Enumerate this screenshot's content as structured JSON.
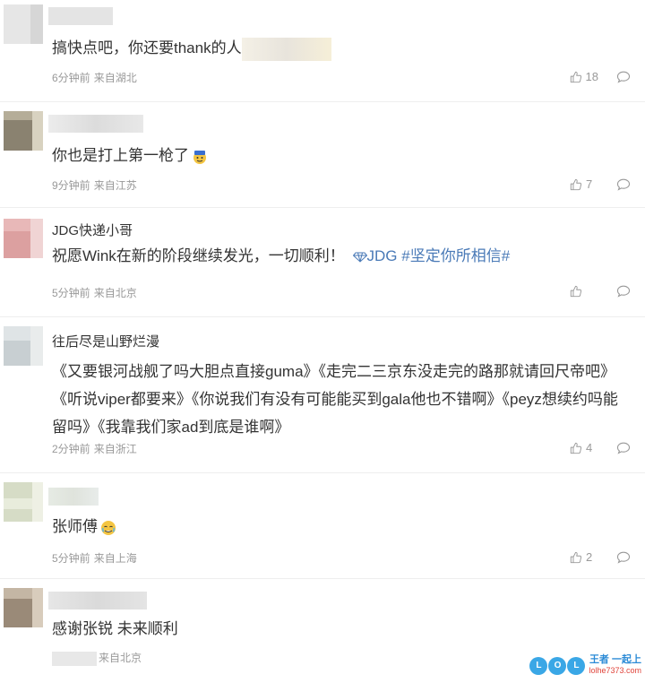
{
  "comments": [
    {
      "name": "",
      "text": "搞快点吧，你还要thank的人",
      "time": "6分钟前",
      "location": "来自湖北",
      "likes": "18"
    },
    {
      "name": "",
      "text": "你也是打上第一枪了",
      "time": "9分钟前",
      "location": "来自江苏",
      "likes": "7"
    },
    {
      "name": "JDG快递小哥",
      "text": "祝愿Wink在新的阶段继续发光，一切顺利！",
      "topic_a": "JDG",
      "topic_b": "#坚定你所相信#",
      "time": "5分钟前",
      "location": "来自北京",
      "likes": ""
    },
    {
      "name": "往后尽是山野烂漫",
      "text": "《又要银河战舰了吗大胆点直接guma》《走完二三京东没走完的路那就请回尺帝吧》《听说viper都要来》《你说我们有没有可能能买到gala他也不错啊》《peyz想续约吗能留吗》《我靠我们家ad到底是谁啊》",
      "time": "2分钟前",
      "location": "来自浙江",
      "likes": "4"
    },
    {
      "name": "",
      "text": "张师傅",
      "time": "5分钟前",
      "location": "来自上海",
      "likes": "2"
    },
    {
      "name": "",
      "text": "感谢张锐 未来顺利",
      "time": "",
      "location": "来自北京",
      "likes": ""
    }
  ],
  "watermark": {
    "badge": [
      "L",
      "O",
      "L"
    ],
    "main": "王者 一起上",
    "url": "lolhe7373.com"
  },
  "icons": {
    "like": "thumbs-up-icon",
    "reply": "comment-bubble-icon"
  },
  "colors": {
    "topic": "#4a7ab7",
    "meta": "#999999",
    "divider": "#eeeeee"
  }
}
